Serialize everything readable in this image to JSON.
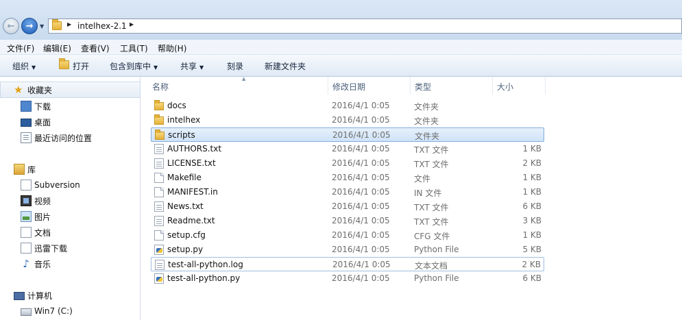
{
  "address": {
    "path_segment": "intelhex-2.1"
  },
  "menu": {
    "items": [
      "文件(F)",
      "编辑(E)",
      "查看(V)",
      "工具(T)",
      "帮助(H)"
    ]
  },
  "toolbar": {
    "organize": "组织",
    "open": "打开",
    "include_in_library": "包含到库中",
    "share": "共享",
    "burn": "刻录",
    "new_folder": "新建文件夹"
  },
  "nav": {
    "favorites": {
      "label": "收藏夹",
      "icon": "star-icon"
    },
    "favorites_items": [
      {
        "label": "下载",
        "icon": "download-folder-icon"
      },
      {
        "label": "桌面",
        "icon": "desktop-icon"
      },
      {
        "label": "最近访问的位置",
        "icon": "recent-places-icon"
      }
    ],
    "libraries": {
      "label": "库",
      "icon": "library-icon"
    },
    "library_items": [
      {
        "label": "Subversion",
        "icon": "document-library-icon"
      },
      {
        "label": "视频",
        "icon": "video-library-icon"
      },
      {
        "label": "图片",
        "icon": "picture-library-icon"
      },
      {
        "label": "文档",
        "icon": "document-library-icon"
      },
      {
        "label": "迅雷下载",
        "icon": "thunder-download-icon"
      },
      {
        "label": "音乐",
        "icon": "music-library-icon"
      }
    ],
    "computer": {
      "label": "计算机",
      "icon": "computer-icon"
    },
    "computer_items": [
      {
        "label": "Win7 (C:)",
        "icon": "drive-icon"
      }
    ]
  },
  "columns": {
    "name": "名称",
    "modified": "修改日期",
    "type": "类型",
    "size": "大小"
  },
  "files": [
    {
      "name": "docs",
      "date": "2016/4/1 0:05",
      "type": "文件夹",
      "size": "",
      "icon": "folder-icon"
    },
    {
      "name": "intelhex",
      "date": "2016/4/1 0:05",
      "type": "文件夹",
      "size": "",
      "icon": "folder-icon"
    },
    {
      "name": "scripts",
      "date": "2016/4/1 0:05",
      "type": "文件夹",
      "size": "",
      "icon": "folder-icon"
    },
    {
      "name": "AUTHORS.txt",
      "date": "2016/4/1 0:05",
      "type": "TXT 文件",
      "size": "1 KB",
      "icon": "text-file-icon"
    },
    {
      "name": "LICENSE.txt",
      "date": "2016/4/1 0:05",
      "type": "TXT 文件",
      "size": "2 KB",
      "icon": "text-file-icon"
    },
    {
      "name": "Makefile",
      "date": "2016/4/1 0:05",
      "type": "文件",
      "size": "1 KB",
      "icon": "file-icon"
    },
    {
      "name": "MANIFEST.in",
      "date": "2016/4/1 0:05",
      "type": "IN 文件",
      "size": "1 KB",
      "icon": "file-icon"
    },
    {
      "name": "News.txt",
      "date": "2016/4/1 0:05",
      "type": "TXT 文件",
      "size": "6 KB",
      "icon": "text-file-icon"
    },
    {
      "name": "Readme.txt",
      "date": "2016/4/1 0:05",
      "type": "TXT 文件",
      "size": "3 KB",
      "icon": "text-file-icon"
    },
    {
      "name": "setup.cfg",
      "date": "2016/4/1 0:05",
      "type": "CFG 文件",
      "size": "1 KB",
      "icon": "file-icon"
    },
    {
      "name": "setup.py",
      "date": "2016/4/1 0:05",
      "type": "Python File",
      "size": "5 KB",
      "icon": "python-file-icon"
    },
    {
      "name": "test-all-python.log",
      "date": "2016/4/1 0:05",
      "type": "文本文档",
      "size": "2 KB",
      "icon": "text-file-icon"
    },
    {
      "name": "test-all-python.py",
      "date": "2016/4/1 0:05",
      "type": "Python File",
      "size": "6 KB",
      "icon": "python-file-icon"
    }
  ],
  "selected_file": "scripts",
  "focused_file": "test-all-python.log"
}
